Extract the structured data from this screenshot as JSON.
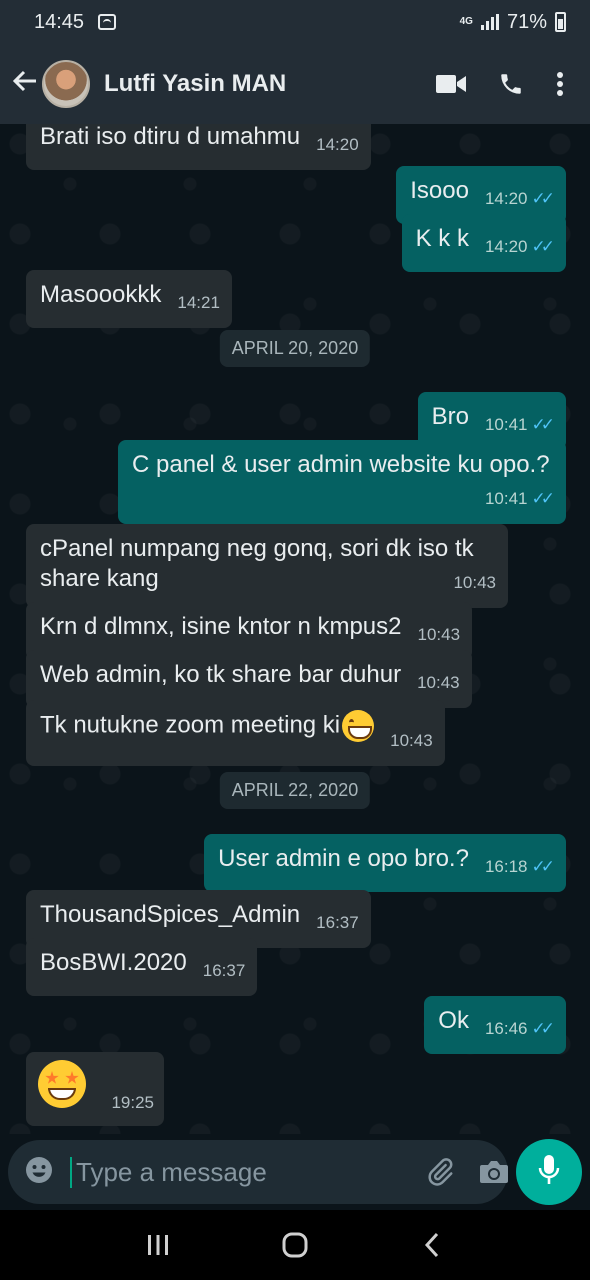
{
  "status_bar": {
    "time": "14:45",
    "network": "4G",
    "battery": "71%"
  },
  "header": {
    "contact_name": "Lutfi Yasin MAN"
  },
  "messages": [
    {
      "text": "Brati iso dtiru d umahmu",
      "time": "14:20"
    },
    {
      "text": "Isooo",
      "time": "14:20"
    },
    {
      "text": "K k k",
      "time": "14:20"
    },
    {
      "text": "Masoookkk",
      "time": "14:21"
    },
    {
      "text": "Bro",
      "time": "10:41"
    },
    {
      "text": "C panel & user admin website ku opo.?",
      "time": "10:41"
    },
    {
      "text": "cPanel numpang neg gonq, sori dk iso tk share kang",
      "time": "10:43"
    },
    {
      "text": "Krn d dlmnx, isine kntor n kmpus2",
      "time": "10:43"
    },
    {
      "text": "Web admin, ko tk share bar duhur",
      "time": "10:43"
    },
    {
      "text": "Tk nutukne zoom meeting ki",
      "time": "10:43"
    },
    {
      "text": "User admin e opo bro.?",
      "time": "16:18"
    },
    {
      "text": "ThousandSpices_Admin",
      "time": "16:37"
    },
    {
      "text": "BosBWI.2020",
      "time": "16:37"
    },
    {
      "text": "Ok",
      "time": "16:46"
    },
    {
      "text": "",
      "time": "19:25"
    }
  ],
  "dates": [
    "APRIL 20, 2020",
    "APRIL 22, 2020"
  ],
  "input": {
    "placeholder": "Type a message"
  },
  "icons": {
    "back": "arrow-left-icon",
    "video": "video-camera-icon",
    "call": "phone-icon",
    "menu": "more-vertical-icon",
    "emoji": "smiley-icon",
    "attach": "paperclip-icon",
    "camera": "camera-icon",
    "mic": "microphone-icon"
  },
  "colors": {
    "incoming": "#262d31",
    "outgoing": "#056162",
    "accent": "#00af9c",
    "ticks": "#4fc3f7"
  }
}
